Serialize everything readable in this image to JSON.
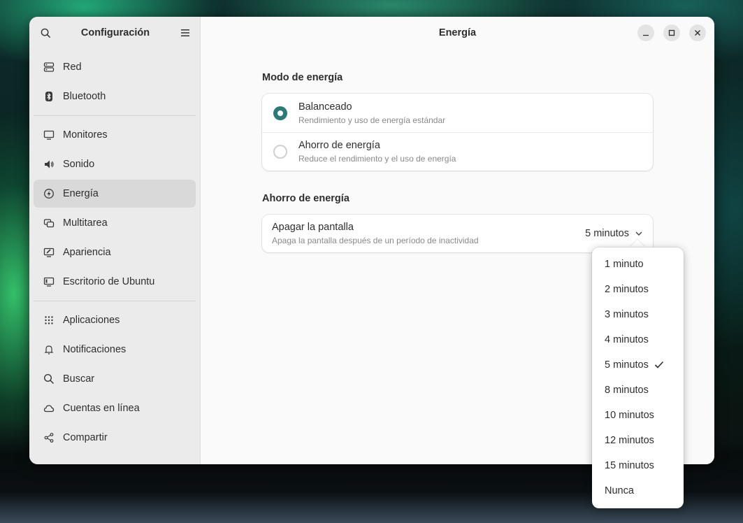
{
  "sidebar": {
    "title": "Configuración",
    "groups": [
      [
        {
          "label": "Red",
          "icon": "network-icon"
        },
        {
          "label": "Bluetooth",
          "icon": "bluetooth-icon"
        }
      ],
      [
        {
          "label": "Monitores",
          "icon": "monitor-icon"
        },
        {
          "label": "Sonido",
          "icon": "speaker-icon"
        },
        {
          "label": "Energía",
          "icon": "power-icon",
          "active": true
        },
        {
          "label": "Multitarea",
          "icon": "multitasking-icon"
        },
        {
          "label": "Apariencia",
          "icon": "appearance-icon"
        },
        {
          "label": "Escritorio de Ubuntu",
          "icon": "ubuntu-desktop-icon"
        }
      ],
      [
        {
          "label": "Aplicaciones",
          "icon": "apps-grid-icon"
        },
        {
          "label": "Notificaciones",
          "icon": "bell-icon"
        },
        {
          "label": "Buscar",
          "icon": "search-icon"
        },
        {
          "label": "Cuentas en línea",
          "icon": "cloud-icon"
        },
        {
          "label": "Compartir",
          "icon": "share-icon"
        }
      ]
    ]
  },
  "header": {
    "title": "Energía"
  },
  "power_mode": {
    "section_title": "Modo de energía",
    "options": [
      {
        "title": "Balanceado",
        "subtitle": "Rendimiento y uso de energía estándar",
        "selected": true
      },
      {
        "title": "Ahorro de energía",
        "subtitle": "Reduce el rendimiento y el uso de energía",
        "selected": false
      }
    ]
  },
  "power_saving": {
    "section_title": "Ahorro de energía",
    "screen_blank": {
      "title": "Apagar la pantalla",
      "subtitle": "Apaga la pantalla después de un período de inactividad",
      "value": "5 minutos"
    }
  },
  "dropdown": {
    "options": [
      "1 minuto",
      "2 minutos",
      "3 minutos",
      "4 minutos",
      "5 minutos",
      "8 minutos",
      "10 minutos",
      "12 minutos",
      "15 minutos",
      "Nunca"
    ],
    "selected_index": 4
  },
  "colors": {
    "accent": "#2b7a78",
    "sidebar_bg": "#ebebeb",
    "content_bg": "#fafafa"
  }
}
